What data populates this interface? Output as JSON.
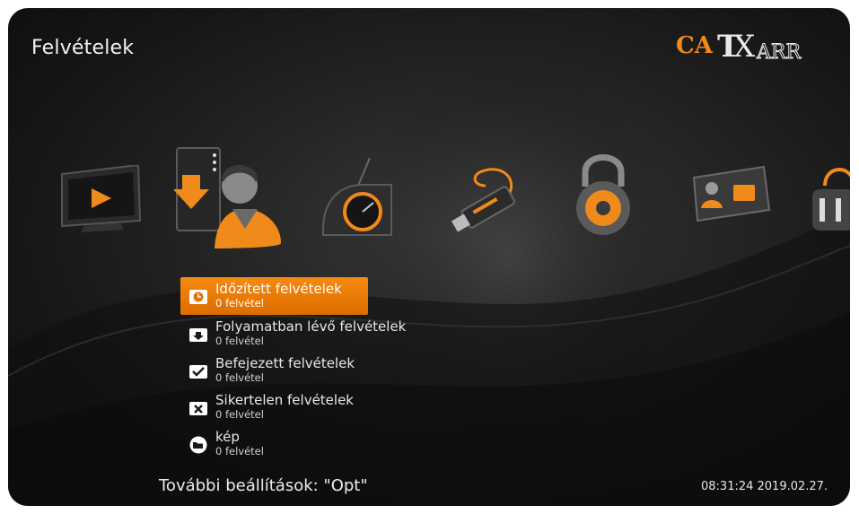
{
  "header": {
    "title": "Felvételek",
    "logo_text": "CATV ARR"
  },
  "carousel": {
    "icons": [
      {
        "name": "tv-play-icon"
      },
      {
        "name": "recordings-user-icon"
      },
      {
        "name": "radio-icon"
      },
      {
        "name": "usb-drive-icon"
      },
      {
        "name": "padlock-icon"
      },
      {
        "name": "smartcard-icon"
      },
      {
        "name": "shield-lock-icon"
      }
    ],
    "selected_index": 1
  },
  "menu": {
    "items": [
      {
        "title": "Időzített felvételek",
        "subtitle": "0 felvétel",
        "icon": "clock-icon",
        "selected": true
      },
      {
        "title": "Folyamatban lévő felvételek",
        "subtitle": "0 felvétel",
        "icon": "download-box-icon",
        "selected": false
      },
      {
        "title": "Befejezett felvételek",
        "subtitle": "0 felvétel",
        "icon": "checkmark-box-icon",
        "selected": false
      },
      {
        "title": "Sikertelen felvételek",
        "subtitle": "0 felvétel",
        "icon": "x-box-icon",
        "selected": false
      },
      {
        "title": "kép",
        "subtitle": "0 felvétel",
        "icon": "folder-icon",
        "selected": false
      }
    ]
  },
  "footer": {
    "hint": "További beállítások: \"Opt\"",
    "datetime": "08:31:24 2019.02.27."
  },
  "colors": {
    "accent": "#f08000",
    "background": "#1b1b1b"
  }
}
